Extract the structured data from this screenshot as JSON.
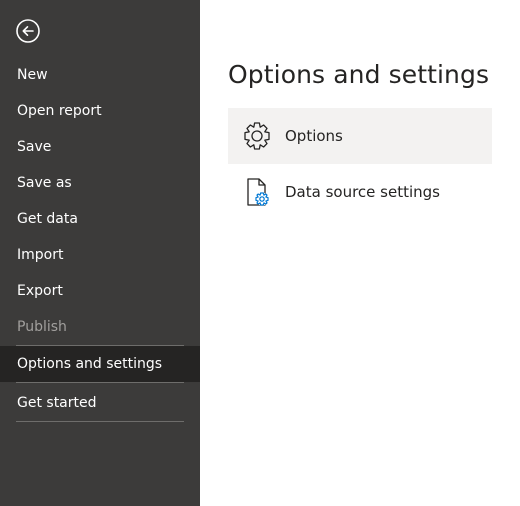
{
  "sidebar": {
    "back_icon": "back-arrow-circle-icon",
    "items": [
      {
        "label": "New"
      },
      {
        "label": "Open report"
      },
      {
        "label": "Save"
      },
      {
        "label": "Save as"
      },
      {
        "label": "Get data"
      },
      {
        "label": "Import"
      },
      {
        "label": "Export"
      },
      {
        "label": "Publish"
      },
      {
        "label": "Options and settings"
      },
      {
        "label": "Get started"
      }
    ],
    "active_item": "Options and settings",
    "disabled_item": "Publish"
  },
  "main": {
    "title": "Options and settings",
    "options": [
      {
        "label": "Options",
        "icon": "gear-icon"
      },
      {
        "label": "Data source settings",
        "icon": "document-gear-icon"
      }
    ],
    "selected_option": "Options"
  },
  "colors": {
    "sidebar_bg": "#3c3b3a",
    "active_item_bg": "#252423",
    "selected_option_bg": "#f3f2f1",
    "accent": "#0078d4"
  }
}
